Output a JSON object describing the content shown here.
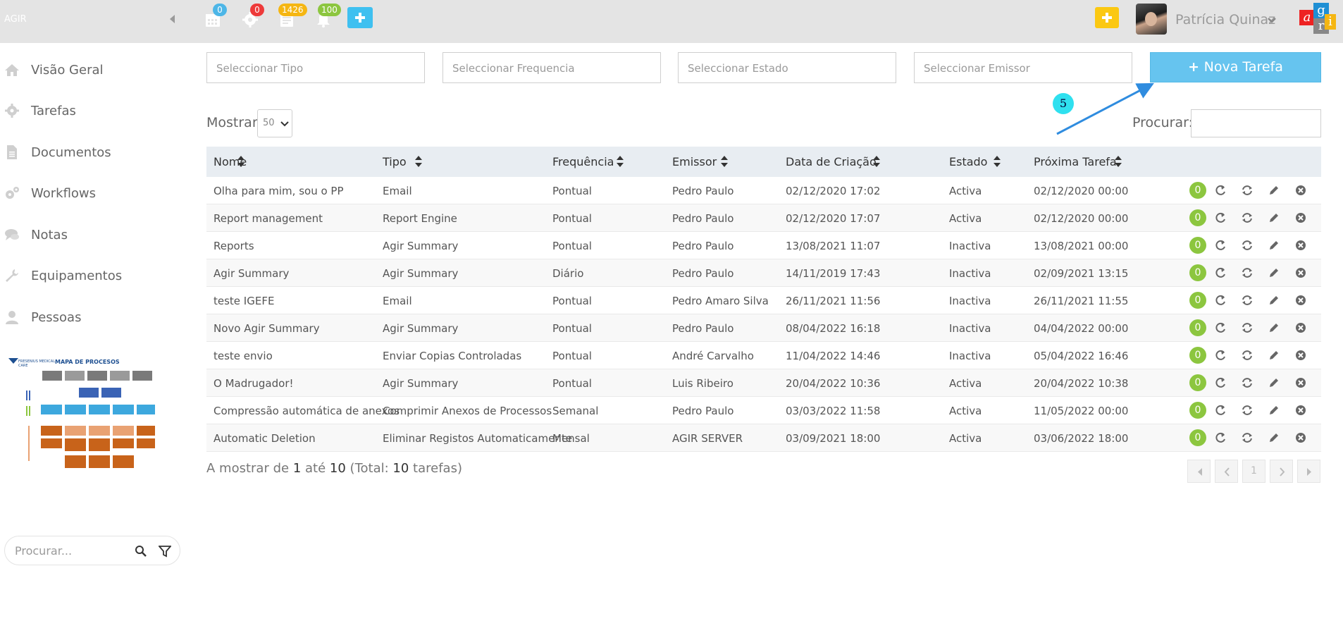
{
  "app": {
    "brand": "AGIR"
  },
  "topbar": {
    "badges": [
      {
        "icon": "calendar-icon",
        "count": "0",
        "color": "#4db6e7"
      },
      {
        "icon": "gear-icon",
        "count": "0",
        "color": "#ee3a3a"
      },
      {
        "icon": "list-icon",
        "count": "1426",
        "color": "#f5b612"
      },
      {
        "icon": "bell-icon",
        "count": "100",
        "color": "#8cc63f"
      }
    ],
    "user_name": "Patrícia Quinaz",
    "logo_letters": [
      "a",
      "g",
      "r",
      "i"
    ]
  },
  "sidebar": {
    "items": [
      {
        "label": "Visão Geral",
        "icon": "home-icon"
      },
      {
        "label": "Tarefas",
        "icon": "gear-icon"
      },
      {
        "label": "Documentos",
        "icon": "document-icon"
      },
      {
        "label": "Workflows",
        "icon": "gears-icon"
      },
      {
        "label": "Notas",
        "icon": "chat-icon"
      },
      {
        "label": "Equipamentos",
        "icon": "wrench-icon"
      },
      {
        "label": "Pessoas",
        "icon": "user-icon"
      }
    ],
    "map": {
      "title": "MAPA DE PROCESOS",
      "logo_text": "FRESENIUS MEDICAL CARE"
    },
    "search_placeholder": "Procurar..."
  },
  "filters": {
    "tipo": "Seleccionar Tipo",
    "frequencia": "Seleccionar Frequencia",
    "estado": "Seleccionar Estado",
    "emissor": "Seleccionar Emissor",
    "new_task_label": "Nova Tarefa"
  },
  "annotation": {
    "label": "5"
  },
  "controls": {
    "show_label": "Mostrar",
    "show_value": "50",
    "search_label": "Procurar:"
  },
  "table": {
    "headers": [
      "Nome",
      "Tipo",
      "Frequência",
      "Emissor",
      "Data de Criação",
      "Estado",
      "Próxima Tarefa"
    ],
    "rows": [
      {
        "nome": "Olha para mim, sou o PP",
        "tipo": "Email",
        "freq": "Pontual",
        "emissor": "Pedro Paulo",
        "criacao": "02/12/2020 17:02",
        "estado": "Activa",
        "proxima": "02/12/2020 00:00",
        "count": "0"
      },
      {
        "nome": "Report management",
        "tipo": "Report Engine",
        "freq": "Pontual",
        "emissor": "Pedro Paulo",
        "criacao": "02/12/2020 17:07",
        "estado": "Activa",
        "proxima": "02/12/2020 00:00",
        "count": "0"
      },
      {
        "nome": "Reports",
        "tipo": "Agir Summary",
        "freq": "Pontual",
        "emissor": "Pedro Paulo",
        "criacao": "13/08/2021 11:07",
        "estado": "Inactiva",
        "proxima": "13/08/2021 00:00",
        "count": "0"
      },
      {
        "nome": "Agir Summary",
        "tipo": "Agir Summary",
        "freq": "Diário",
        "emissor": "Pedro Paulo",
        "criacao": "14/11/2019 17:43",
        "estado": "Inactiva",
        "proxima": "02/09/2021 13:15",
        "count": "0"
      },
      {
        "nome": "teste IGEFE",
        "tipo": "Email",
        "freq": "Pontual",
        "emissor": "Pedro Amaro Silva",
        "criacao": "26/11/2021 11:56",
        "estado": "Inactiva",
        "proxima": "26/11/2021 11:55",
        "count": "0"
      },
      {
        "nome": "Novo Agir Summary",
        "tipo": "Agir Summary",
        "freq": "Pontual",
        "emissor": "Pedro Paulo",
        "criacao": "08/04/2022 16:18",
        "estado": "Inactiva",
        "proxima": "04/04/2022 00:00",
        "count": "0"
      },
      {
        "nome": "teste envio",
        "tipo": "Enviar Copias Controladas",
        "freq": "Pontual",
        "emissor": "André Carvalho",
        "criacao": "11/04/2022 14:46",
        "estado": "Inactiva",
        "proxima": "05/04/2022 16:46",
        "count": "0"
      },
      {
        "nome": "O Madrugador!",
        "tipo": "Agir Summary",
        "freq": "Pontual",
        "emissor": "Luis Ribeiro",
        "criacao": "20/04/2022 10:36",
        "estado": "Activa",
        "proxima": "20/04/2022 10:38",
        "count": "0"
      },
      {
        "nome": "Compressão automática de anexos",
        "tipo": "Comprimir Anexos de Processos",
        "freq": "Semanal",
        "emissor": "Pedro Paulo",
        "criacao": "03/03/2022 11:58",
        "estado": "Activa",
        "proxima": "11/05/2022 00:00",
        "count": "0"
      },
      {
        "nome": "Automatic Deletion",
        "tipo": "Eliminar Registos Automaticamente",
        "freq": "Mensal",
        "emissor": "AGIR SERVER",
        "criacao": "03/09/2021 18:00",
        "estado": "Activa",
        "proxima": "03/06/2022 18:00",
        "count": "0"
      }
    ]
  },
  "footer": {
    "prefix": "A mostrar de",
    "from": "1",
    "mid": "até",
    "to": "10",
    "total_prefix": "(Total:",
    "total": "10",
    "total_suffix": "tarefas)",
    "current_page": "1"
  }
}
